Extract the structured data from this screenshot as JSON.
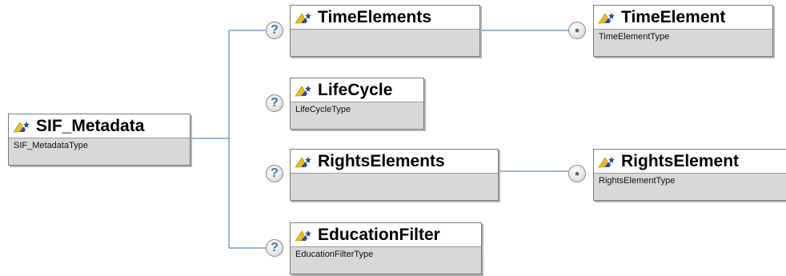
{
  "root": {
    "name": "SIF_Metadata",
    "type": "SIF_MetadataType"
  },
  "children": [
    {
      "name": "TimeElements",
      "type": "",
      "cardinality": "?",
      "child": {
        "name": "TimeElement",
        "type": "TimeElementType",
        "cardinality": "*"
      }
    },
    {
      "name": "LifeCycle",
      "type": "LifeCycleType",
      "cardinality": "?"
    },
    {
      "name": "RightsElements",
      "type": "",
      "cardinality": "?",
      "child": {
        "name": "RightsElement",
        "type": "RightsElementType",
        "cardinality": "*"
      }
    },
    {
      "name": "EducationFilter",
      "type": "EducationFilterType",
      "cardinality": "?"
    }
  ],
  "colors": {
    "connector": "#3d6fa6",
    "icon_yellow": "#f2c200",
    "icon_blue": "#2c4a9c",
    "type_bar": "#d8d8d8"
  },
  "icon_name": "element-icon"
}
